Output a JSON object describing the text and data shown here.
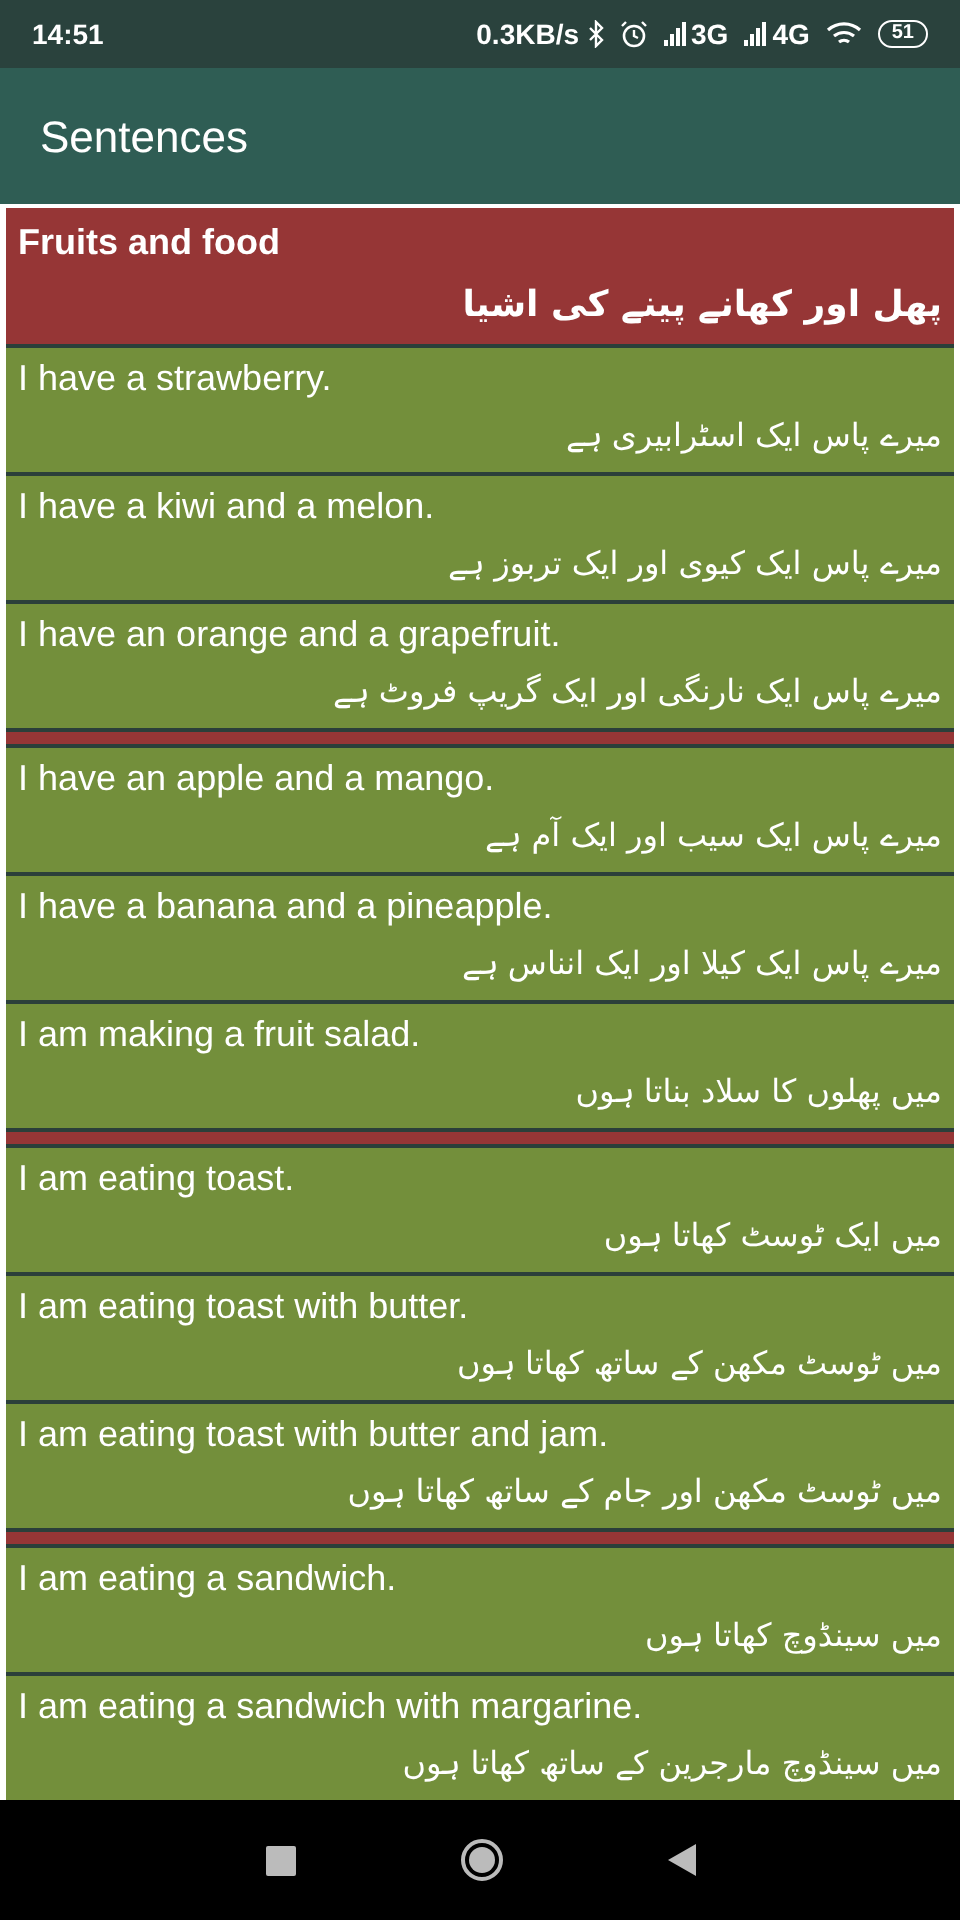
{
  "status_bar": {
    "time": "14:51",
    "speed": "0.3KB/s",
    "network_1": "3G",
    "network_2": "4G",
    "battery": "51"
  },
  "app_bar": {
    "title": "Sentences"
  },
  "groups": [
    {
      "title": "Fruits and food",
      "title_translation": "پھل اور کھانے پینے کی اشیا",
      "sentences": [
        {
          "text": "I have a strawberry.",
          "translation": "میرے پاس ایک اسٹرابیری ہے"
        },
        {
          "text": "I have a kiwi and a melon.",
          "translation": "میرے پاس ایک کیوی اور ایک تربوز ہے"
        },
        {
          "text": "I have an orange and a grapefruit.",
          "translation": "میرے پاس ایک نارنگی اور ایک گریپ فروٹ ہے"
        }
      ]
    },
    {
      "sentences": [
        {
          "text": "I have an apple and a mango.",
          "translation": "میرے پاس ایک سیب اور ایک آم ہے"
        },
        {
          "text": "I have a banana and a pineapple.",
          "translation": "میرے پاس ایک کیلا اور ایک انناس ہے"
        },
        {
          "text": "I am making a fruit salad.",
          "translation": "میں پھلوں کا سلاد بناتا ہوں"
        }
      ]
    },
    {
      "sentences": [
        {
          "text": "I am eating toast.",
          "translation": "میں ایک ٹوسٹ کھاتا ہوں"
        },
        {
          "text": "I am eating toast with butter.",
          "translation": "میں ٹوسٹ مکھن کے ساتھ کھاتا ہوں"
        },
        {
          "text": "I am eating toast with butter and jam.",
          "translation": "میں ٹوسٹ مکھن اور جام کے ساتھ کھاتا ہوں"
        }
      ]
    },
    {
      "sentences": [
        {
          "text": "I am eating a sandwich.",
          "translation": "میں سینڈوچ کھاتا ہوں"
        },
        {
          "text": "I am eating a sandwich with margarine.",
          "translation": "میں سینڈوچ مارجرین کے ساتھ کھاتا ہوں"
        }
      ]
    }
  ]
}
